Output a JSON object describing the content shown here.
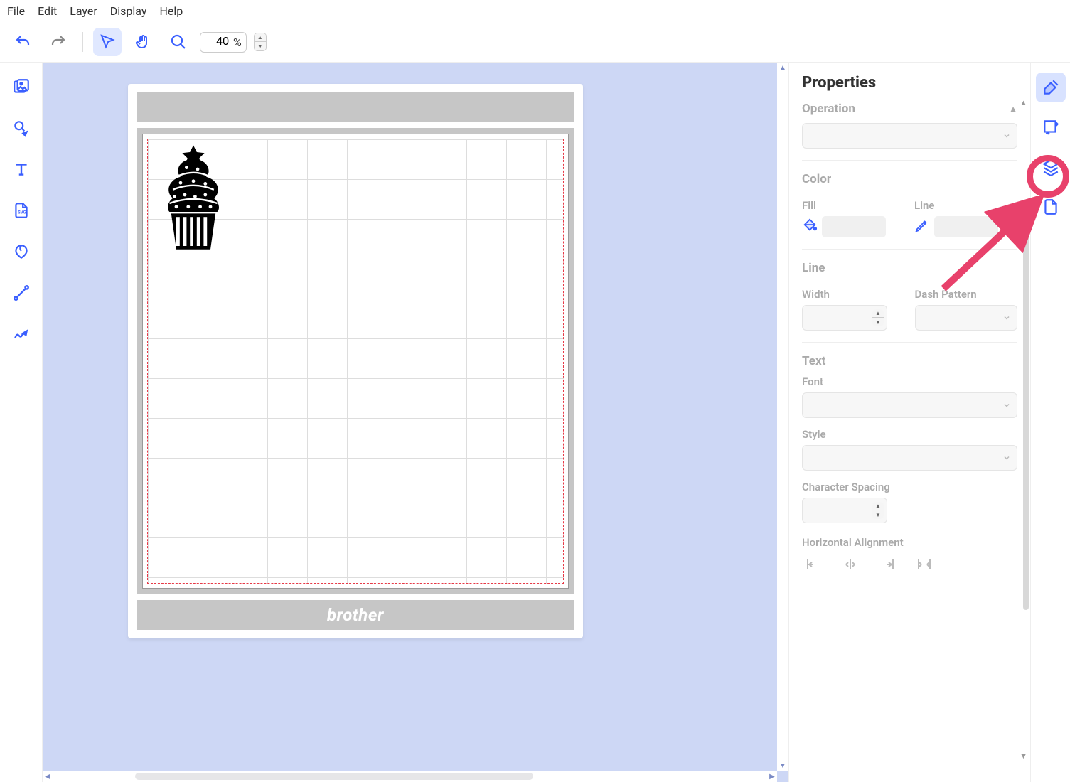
{
  "menu": {
    "file": "File",
    "edit": "Edit",
    "layer": "Layer",
    "display": "Display",
    "help": "Help"
  },
  "toolbar": {
    "zoom_value": "40",
    "zoom_unit": "%"
  },
  "properties": {
    "title": "Properties",
    "operation": "Operation",
    "color": "Color",
    "fill": "Fill",
    "line": "Line",
    "line_section": "Line",
    "width": "Width",
    "dash_pattern": "Dash Pattern",
    "text": "Text",
    "font": "Font",
    "style": "Style",
    "char_spacing": "Character Spacing",
    "h_align": "Horizontal Alignment"
  },
  "mat": {
    "brand": "brother"
  }
}
